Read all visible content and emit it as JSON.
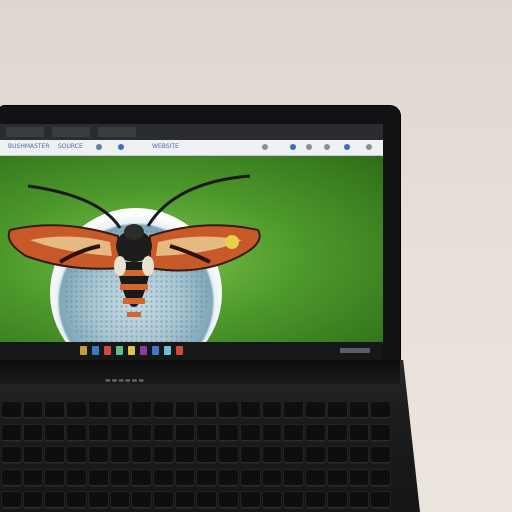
{
  "browser": {
    "tab_left_text": "BUSHMASTER",
    "tab_middle_text": "SOURCE",
    "address_text": "WEBSITE"
  },
  "colors": {
    "wallpaper_green": "#4e9a2c",
    "moth_orange": "#d2672e",
    "bezel": "#111214",
    "background_wall": "#e6dfd8"
  },
  "icons": [
    "browser-back-icon",
    "search-icon",
    "settings-icon",
    "user-icon",
    "taskbar-app-icons"
  ]
}
